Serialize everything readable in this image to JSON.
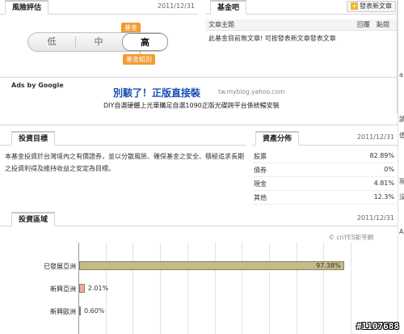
{
  "risk": {
    "title": "風險評估",
    "date": "2011/12/31",
    "levels": [
      "低",
      "中",
      "高"
    ],
    "active": "高",
    "tag_fund": "基金",
    "tag_group": "基金組別"
  },
  "fundbar": {
    "title": "基金吧",
    "post_button": "發表新文章",
    "col_subject": "文章主題",
    "col_reply": "回覆",
    "col_views": "點閱",
    "empty_msg": "此基金目前無文章! 可按發表新文章發表文章"
  },
  "ads": {
    "by": "Ads by Google",
    "title": "別駭了！正版直接裝",
    "url": "tw.myblog.yahoo.com",
    "desc": "DIY自選硬體上光華購足自選1090正版光碟跨平台係統暢安裝"
  },
  "objective": {
    "title": "投資目標",
    "text": "本基金投資於台灣境內之有價證券，並以分散風險、確保基金之安全、積極追求長期之投資利得及維持收益之安定為目標。"
  },
  "allocation": {
    "title": "資產分佈",
    "date": "2011/12/31",
    "rows": [
      {
        "name": "股票",
        "value": "82.89%"
      },
      {
        "name": "債券",
        "value": "0%"
      },
      {
        "name": "現金",
        "value": "4.81%"
      },
      {
        "name": "其他",
        "value": "12.3%"
      }
    ]
  },
  "region": {
    "title": "投資區域",
    "date": "2011/12/31",
    "source": "© cnYES鉅亨網"
  },
  "chart_data": {
    "type": "bar",
    "orientation": "horizontal",
    "categories": [
      "已發展亞洲",
      "新興亞洲",
      "新興歐洲"
    ],
    "values": [
      97.38,
      2.01,
      0.6
    ],
    "value_labels": [
      "97.38%",
      "2.01%",
      "0.60%"
    ],
    "xlim": [
      0,
      100
    ],
    "grid": true,
    "colors": [
      "#c2bb8a",
      "#f2a7a7",
      "#8fb3e6"
    ]
  },
  "right_strip": [
    "a",
    "讀",
    "值",
    "現",
    "沒",
    "A"
  ],
  "watermark": "#1107688"
}
